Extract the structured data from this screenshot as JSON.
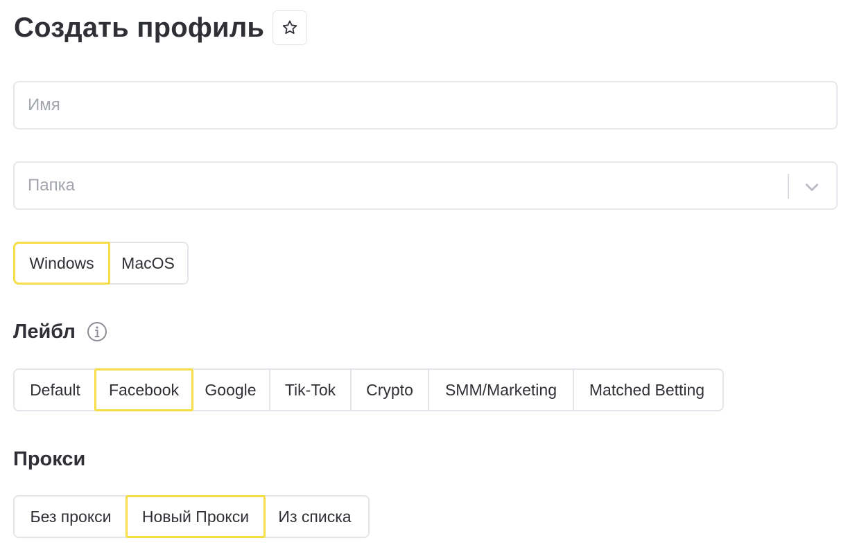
{
  "header": {
    "title": "Создать профиль",
    "favorite_icon": "star-outline-icon"
  },
  "form": {
    "name_placeholder": "Имя",
    "name_value": "",
    "folder_placeholder": "Папка",
    "folder_value": "",
    "folder_dropdown_icon": "chevron-down-icon"
  },
  "os": {
    "options": [
      "Windows",
      "MacOS"
    ],
    "selected": "Windows"
  },
  "label_section": {
    "title": "Лейбл",
    "info_icon": "info-circle-icon",
    "options": [
      "Default",
      "Facebook",
      "Google",
      "Tik-Tok",
      "Crypto",
      "SMM/Marketing",
      "Matched Betting"
    ],
    "selected": "Facebook"
  },
  "proxy_section": {
    "title": "Прокси",
    "options": [
      "Без прокси",
      "Новый Прокси",
      "Из списка"
    ],
    "selected": "Новый Прокси"
  },
  "colors": {
    "accent": "#f5dd46",
    "border": "#e4e5ea",
    "text": "#2f3035",
    "placeholder": "#a3a5ad"
  }
}
